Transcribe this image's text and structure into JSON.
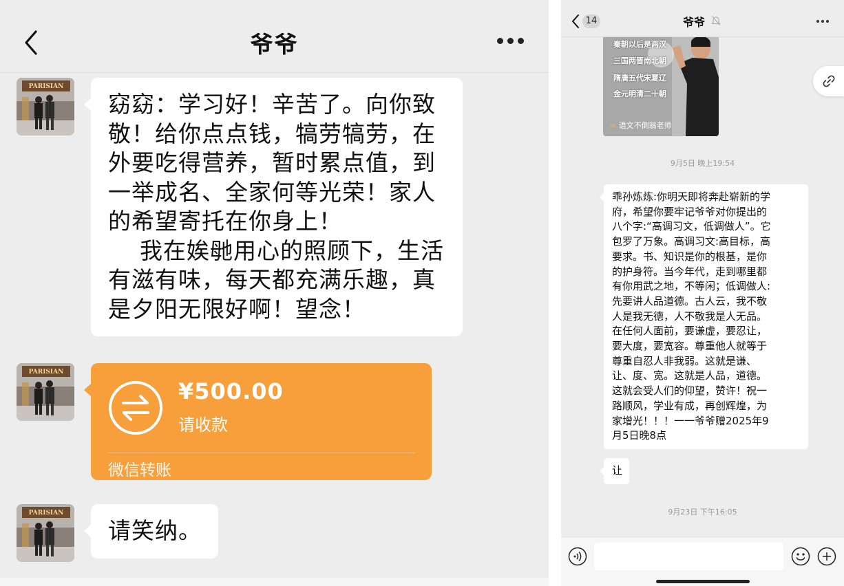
{
  "left": {
    "header": {
      "title": "爷爷",
      "back_icon": "chevron-left-icon",
      "more_icon": "more-icon"
    },
    "messages": [
      {
        "type": "text",
        "text": "窈窈：学习好！辛苦了。向你致\n敬！给你点点钱，犒劳犒劳，在\n外要吃得营养，暂时累点值，到\n一举成名、全家何等光荣！家人\n的希望寄托在你身上！\n    我在娭毑用心的照顾下，生活\n有滋有味，每天都充满乐趣，真\n是夕阳无限好啊！望念！"
      },
      {
        "type": "transfer",
        "amount": "¥500.00",
        "status": "请收款",
        "footer": "微信转账",
        "color": "#f79f3b"
      },
      {
        "type": "text",
        "text": "请笑纳。"
      }
    ]
  },
  "right": {
    "header": {
      "title": "爷爷",
      "unread_count": "14",
      "muted_icon": "muted-bell-icon",
      "more_icon": "more-icon"
    },
    "video_card": {
      "lines": [
        "秦朝以后是两汉",
        "三国两晋南北朝",
        "隋唐五代宋夏辽",
        "金元明清二十朝"
      ],
      "caption": "语文不倒翁老师"
    },
    "timestamps": [
      "9月5日 晚上19:54",
      "9月23日 下午16:05"
    ],
    "messages": [
      {
        "type": "text",
        "text": "乖孙炼炼:你明天即将奔赴崭新的学\n府，希望你要牢记爷爷对你提出的\n八个字:“高调习文，低调做人”。它\n包罗了万象。高调习文:高目标，高\n要求。书、知识是你的根基，是你\n的护身符。当今年代，走到哪里都\n有你用武之地，不等闲；低调做人:\n先要讲人品道德。古人云，我不敬\n人是我无德，人不敬我是人无品。\n在任何人面前，要谦虚，要忍让，\n要大度，要宽容。尊重他人就等于\n尊重自忍人非我弱。这就是谦、\n让、度、宽。这就是人品，道德。\n这就会受人们的仰望，赞许！祝一\n路顺风，学业有成，再创辉煌，为\n家增光！！！一一爷爷赠2025年9\n月5日晚8点"
      },
      {
        "type": "text",
        "text": "让"
      }
    ],
    "input_bar": {
      "placeholder": "",
      "voice_icon": "voice-icon",
      "emoji_icon": "emoji-icon",
      "plus_icon": "plus-icon"
    }
  },
  "colors": {
    "chat_bg": "#ededed",
    "bubble": "#ffffff",
    "transfer": "#f79f3b"
  }
}
